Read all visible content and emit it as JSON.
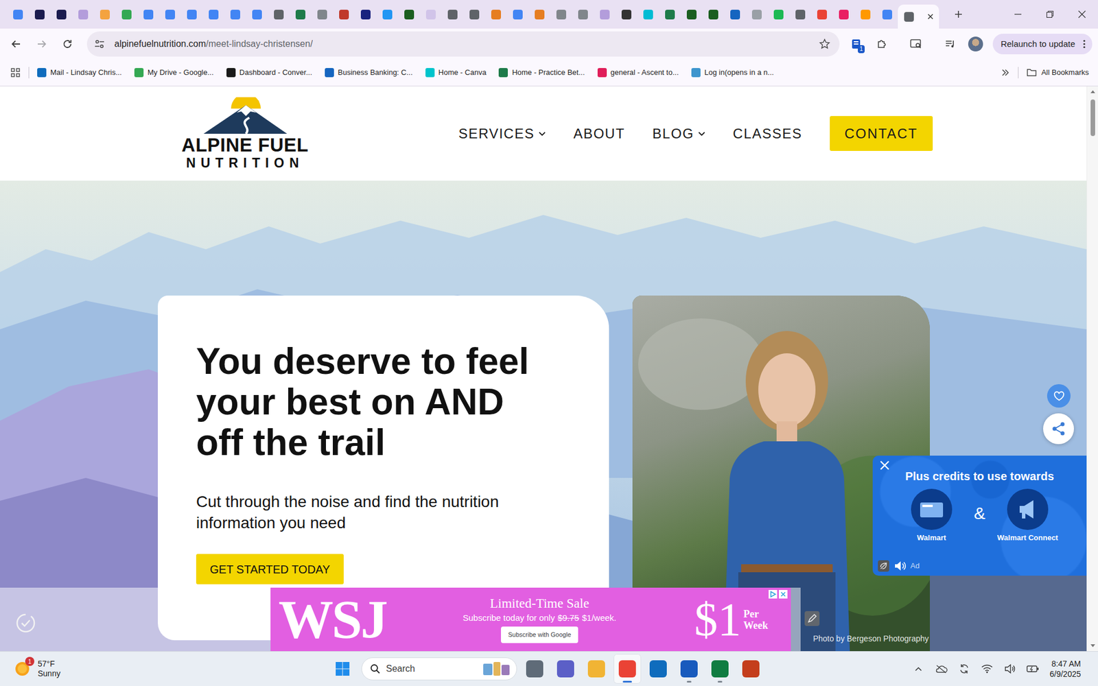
{
  "browser": {
    "tabs": [
      {
        "color": "#4285f4",
        "selected": false
      },
      {
        "color": "#1b1b4f",
        "selected": false
      },
      {
        "color": "#1b1b4f",
        "selected": false
      },
      {
        "color": "#b39ddb",
        "selected": false
      },
      {
        "color": "#f4a340",
        "selected": false
      },
      {
        "color": "#34a853",
        "selected": false
      },
      {
        "color": "#4285f4",
        "selected": false
      },
      {
        "color": "#4285f4",
        "selected": false
      },
      {
        "color": "#4285f4",
        "selected": false
      },
      {
        "color": "#4285f4",
        "selected": false
      },
      {
        "color": "#4285f4",
        "selected": false
      },
      {
        "color": "#4285f4",
        "selected": false
      },
      {
        "color": "#5f6368",
        "selected": false
      },
      {
        "color": "#1e7b4a",
        "selected": false
      },
      {
        "color": "#80868b",
        "selected": false
      },
      {
        "color": "#c0392b",
        "selected": false
      },
      {
        "color": "#1a237e",
        "selected": false
      },
      {
        "color": "#2196f3",
        "selected": false
      },
      {
        "color": "#1b5e20",
        "selected": false
      },
      {
        "color": "#d1c4e9",
        "selected": false
      },
      {
        "color": "#5f6368",
        "selected": false
      },
      {
        "color": "#5f6368",
        "selected": false
      },
      {
        "color": "#e67e22",
        "selected": false
      },
      {
        "color": "#4285f4",
        "selected": false
      },
      {
        "color": "#e67e22",
        "selected": false
      },
      {
        "color": "#80868b",
        "selected": false
      },
      {
        "color": "#80868b",
        "selected": false
      },
      {
        "color": "#b39ddb",
        "selected": false
      },
      {
        "color": "#333333",
        "selected": false
      },
      {
        "color": "#00bcd4",
        "selected": false
      },
      {
        "color": "#1e7b4a",
        "selected": false
      },
      {
        "color": "#1b5e20",
        "selected": false
      },
      {
        "color": "#1b5e20",
        "selected": false
      },
      {
        "color": "#1565c0",
        "selected": false
      },
      {
        "color": "#9aa0a6",
        "selected": false
      },
      {
        "color": "#1db954",
        "selected": false
      },
      {
        "color": "#5f6368",
        "selected": false
      },
      {
        "color": "#ea4335",
        "selected": false
      },
      {
        "color": "#e91e63",
        "selected": false
      },
      {
        "color": "#ff9900",
        "selected": false
      },
      {
        "color": "#4285f4",
        "selected": false
      },
      {
        "color": "#5f6368",
        "selected": true
      }
    ],
    "url": {
      "domain": "alpinefuelnutrition.com",
      "path": "/meet-lindsay-christensen/"
    },
    "extension_badge": "1",
    "relaunch": "Relaunch to update",
    "bookmarks": [
      {
        "label": "Mail - Lindsay Chris...",
        "color": "#0f6cbd"
      },
      {
        "label": "My Drive - Google...",
        "color": "#34a853"
      },
      {
        "label": "Dashboard - Conver...",
        "color": "#1a1a1a"
      },
      {
        "label": "Business Banking: C...",
        "color": "#1565c0"
      },
      {
        "label": "Home - Canva",
        "color": "#00c4cc"
      },
      {
        "label": "Home - Practice Bet...",
        "color": "#1e7b4a"
      },
      {
        "label": "general - Ascent to...",
        "color": "#e01e5a"
      },
      {
        "label": "Log in(opens in a n...",
        "color": "#3d95ce"
      }
    ],
    "all_bookmarks": "All Bookmarks"
  },
  "site": {
    "logo": {
      "line1": "ALPINE FUEL",
      "line2": "NUTRITION"
    },
    "nav": [
      {
        "label": "SERVICES",
        "dropdown": true
      },
      {
        "label": "ABOUT",
        "dropdown": false
      },
      {
        "label": "BLOG",
        "dropdown": true
      },
      {
        "label": "CLASSES",
        "dropdown": false
      }
    ],
    "contact": "CONTACT",
    "hero": {
      "heading": "You deserve to feel your best on AND off the trail",
      "subheading": "Cut through the noise and find the nutrition information you need",
      "button": "GET STARTED TODAY",
      "photo_credit": "Photo by Bergeson Photography"
    }
  },
  "ads": {
    "walmart": {
      "title": "Plus credits to use towards",
      "items": [
        "Walmart",
        "Walmart Connect"
      ],
      "joiner": "&",
      "label": "Ad"
    },
    "wsj": {
      "logo": "WSJ",
      "headline": "Limited-Time Sale",
      "offer_prefix": "Subscribe today for only",
      "old_price": "$9.75",
      "new_price": "$1/week.",
      "button": "Subscribe with Google",
      "big_price": "$1",
      "per": "Per",
      "week": "Week"
    }
  },
  "taskbar": {
    "weather": {
      "temp": "57°F",
      "condition": "Sunny",
      "badge": "1"
    },
    "search": {
      "placeholder": "Search"
    },
    "apps": [
      {
        "color": "#5f6b78",
        "running": false,
        "selected": false
      },
      {
        "color": "#5b5fc7",
        "running": false,
        "selected": false
      },
      {
        "color": "#f1b434",
        "running": false,
        "selected": false
      },
      {
        "color": "#ea4335",
        "running": true,
        "selected": true
      },
      {
        "color": "#0f6cbd",
        "running": false,
        "selected": false
      },
      {
        "color": "#185abd",
        "running": true,
        "selected": false
      },
      {
        "color": "#107c41",
        "running": true,
        "selected": false
      },
      {
        "color": "#c43e1c",
        "running": false,
        "selected": false
      }
    ],
    "clock": {
      "time": "8:47 AM",
      "date": "6/9/2025"
    }
  }
}
